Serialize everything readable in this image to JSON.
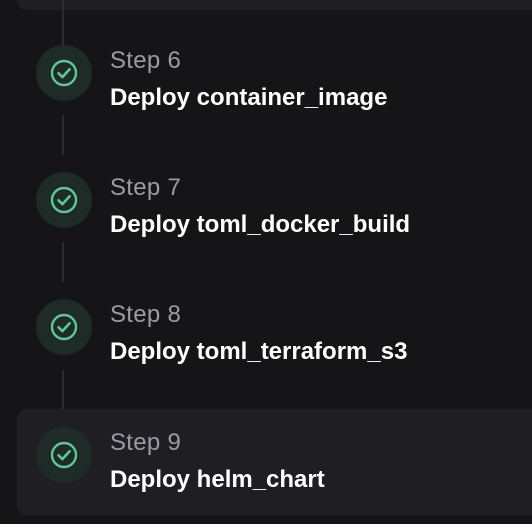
{
  "steps": [
    {
      "number": "Step 6",
      "title": "Deploy container_image",
      "status": "success",
      "icon": "check-circle-icon"
    },
    {
      "number": "Step 7",
      "title": "Deploy toml_docker_build",
      "status": "success",
      "icon": "check-circle-icon"
    },
    {
      "number": "Step 8",
      "title": "Deploy toml_terraform_s3",
      "status": "success",
      "icon": "check-circle-icon"
    },
    {
      "number": "Step 9",
      "title": "Deploy helm_chart",
      "status": "success",
      "icon": "check-circle-icon",
      "selected": true
    }
  ],
  "colors": {
    "background": "#151417",
    "card": "#1f1e22",
    "success": "#5ec79a",
    "success_bg": "#1f2b27",
    "muted_text": "#9c9ba3",
    "title_text": "#ffffff"
  }
}
